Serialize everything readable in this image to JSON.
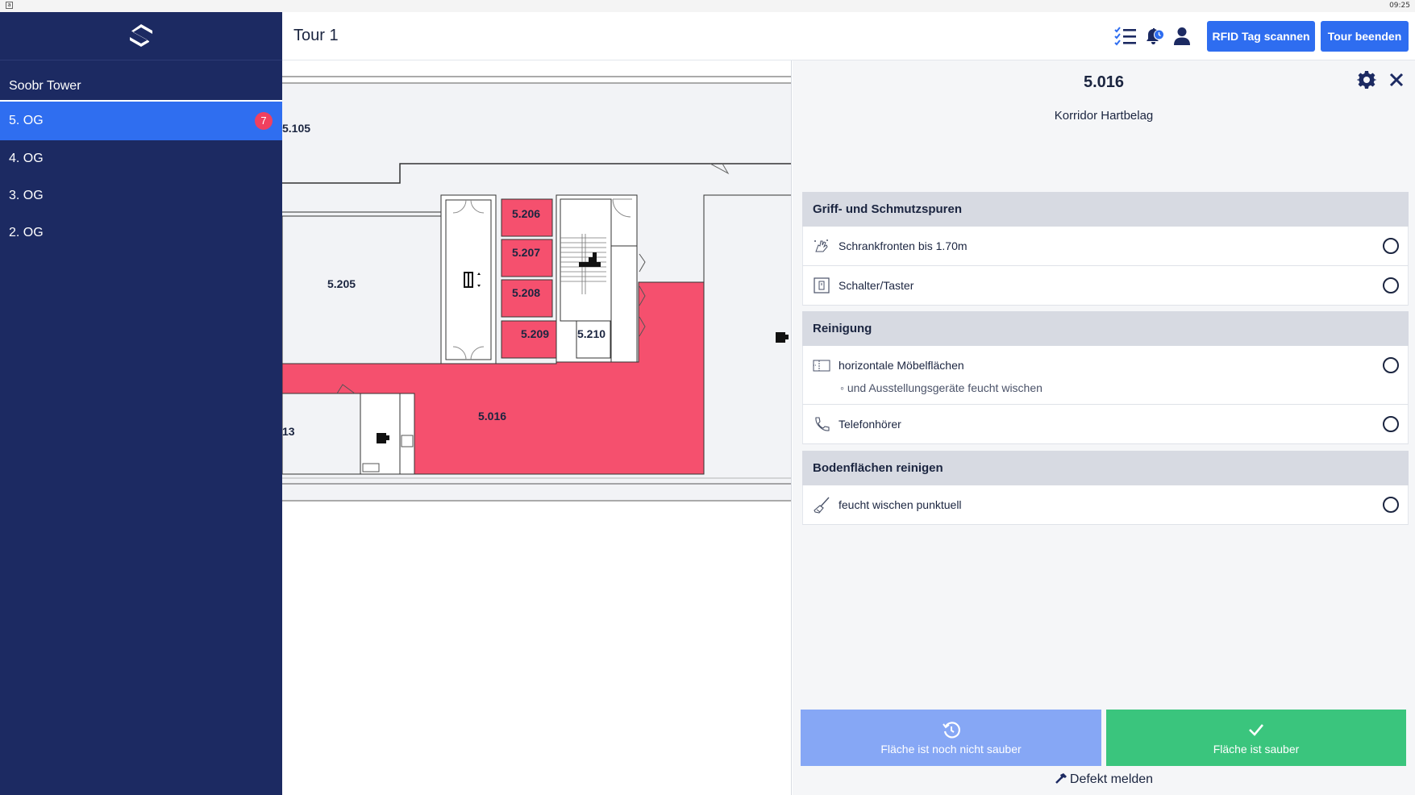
{
  "status_bar": {
    "time": "09:25",
    "app_indicator": "a"
  },
  "sidebar": {
    "building": "Soobr Tower",
    "floors": [
      {
        "label": "5. OG",
        "badge": "7",
        "active": true
      },
      {
        "label": "4. OG"
      },
      {
        "label": "3. OG"
      },
      {
        "label": "2. OG"
      }
    ]
  },
  "header": {
    "title": "Tour 1",
    "icons": [
      "checklist-icon",
      "bell-clock-icon",
      "user-icon"
    ],
    "rfid_button": "RFID Tag scannen",
    "end_button": "Tour beenden"
  },
  "map": {
    "highlight_color": "#f5506e",
    "rooms": [
      {
        "id": "5.105",
        "highlighted": false
      },
      {
        "id": "5.205",
        "highlighted": false
      },
      {
        "id": "5.206",
        "highlighted": true
      },
      {
        "id": "5.207",
        "highlighted": true
      },
      {
        "id": "5.208",
        "highlighted": true
      },
      {
        "id": "5.209",
        "highlighted": true
      },
      {
        "id": "5.210",
        "highlighted": false
      },
      {
        "id": "5.016",
        "highlighted": true
      },
      {
        "id": "13",
        "highlighted": false
      }
    ]
  },
  "panel": {
    "room_number": "5.016",
    "room_type": "Korridor Hartbelag",
    "sections": [
      {
        "title": "Griff- und Schmutzspuren",
        "tasks": [
          {
            "icon": "hand-smudge-icon",
            "label": "Schrankfronten bis 1.70m"
          },
          {
            "icon": "switch-icon",
            "label": "Schalter/Taster"
          }
        ]
      },
      {
        "title": "Reinigung",
        "tasks": [
          {
            "icon": "furniture-surface-icon",
            "label": "horizontale Möbelflächen",
            "sub": "und Ausstellungsgeräte feucht wischen"
          },
          {
            "icon": "phone-icon",
            "label": "Telefonhörer"
          }
        ]
      },
      {
        "title": "Bodenflächen reinigen",
        "tasks": [
          {
            "icon": "mop-icon",
            "label": "feucht wischen punktuell"
          }
        ]
      }
    ],
    "not_clean_button": "Fläche ist noch nicht sauber",
    "clean_button": "Fläche ist sauber",
    "defect_link": "Defekt melden"
  },
  "colors": {
    "sidebar": "#1c2a62",
    "accent": "#2e6df0",
    "success": "#3ac57d",
    "badge": "#f0405f"
  }
}
